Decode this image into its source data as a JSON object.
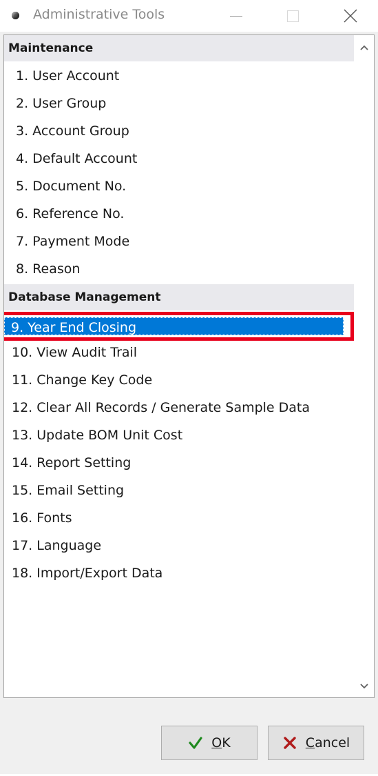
{
  "window": {
    "title": "Administrative Tools"
  },
  "groups": [
    {
      "header": "Maintenance",
      "items": [
        {
          "label": "1. User Account"
        },
        {
          "label": "2. User Group"
        },
        {
          "label": "3. Account Group"
        },
        {
          "label": "4. Default Account"
        },
        {
          "label": "5. Document No."
        },
        {
          "label": "6. Reference No."
        },
        {
          "label": "7. Payment Mode"
        },
        {
          "label": "8. Reason"
        }
      ]
    },
    {
      "header": "Database Management",
      "items": [
        {
          "label": "9. Year End Closing",
          "selected": true
        },
        {
          "label": "10. View Audit Trail"
        },
        {
          "label": "11. Change Key Code"
        },
        {
          "label": "12. Clear All Records / Generate Sample Data"
        },
        {
          "label": "13. Update BOM Unit Cost"
        },
        {
          "label": "14. Report Setting"
        },
        {
          "label": "15. Email Setting"
        },
        {
          "label": "16. Fonts"
        },
        {
          "label": "17. Language"
        },
        {
          "label": "18. Import/Export Data"
        }
      ]
    }
  ],
  "buttons": {
    "ok": {
      "accel": "O",
      "rest": "K"
    },
    "cancel": {
      "accel": "C",
      "rest": "ancel"
    }
  },
  "colors": {
    "selection": "#0078d7",
    "highlight_frame": "#e8001c",
    "ok_icon": "#1f8a1f",
    "cancel_icon": "#b01c1c"
  }
}
